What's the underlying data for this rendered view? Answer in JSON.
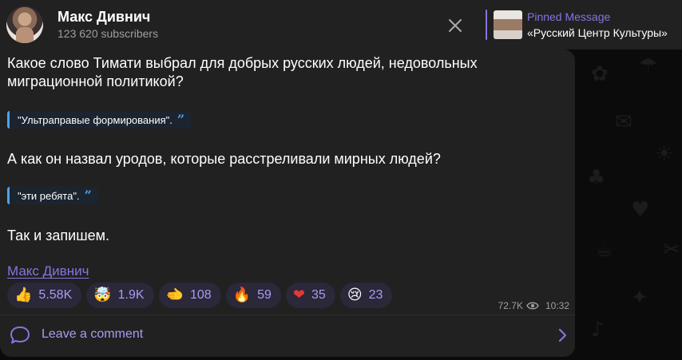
{
  "header": {
    "channel_name": "Макс Дивнич",
    "subscribers": "123 620 subscribers"
  },
  "pinned": {
    "title": "Pinned Message",
    "text": "«Русский Центр Культуры»"
  },
  "message": {
    "line1": "Какое слово Тимати выбрал для добрых русских людей, недовольных",
    "line2": "миграционной политикой?",
    "quote1": "\"Ультраправые формирования\".",
    "line3": "А как он назвал уродов, которые расстреливали мирных людей?",
    "quote2": "\"эти ребята\".",
    "line4": "Так и запишем.",
    "signature": "Макс Дивнич",
    "views": "72.7K",
    "time": "10:32"
  },
  "reactions": [
    {
      "emoji": "👍",
      "count": "5.58K"
    },
    {
      "emoji": "🤯",
      "count": "1.9K"
    },
    {
      "emoji": "🫲",
      "count": "108"
    },
    {
      "emoji": "🔥",
      "count": "59"
    },
    {
      "emoji": "❤",
      "count": "35"
    },
    {
      "emoji": "😢",
      "count": "23"
    }
  ],
  "comments": {
    "label": "Leave a comment"
  },
  "icons": {
    "close": "close-icon",
    "eye": "eye-icon",
    "comment": "comment-bubble-icon",
    "chevron": "chevron-right-icon"
  },
  "colors": {
    "accent": "#8774e1",
    "quote_accent": "#4aa3ef",
    "bubble": "#212121",
    "reaction_bg": "#2a2839"
  }
}
